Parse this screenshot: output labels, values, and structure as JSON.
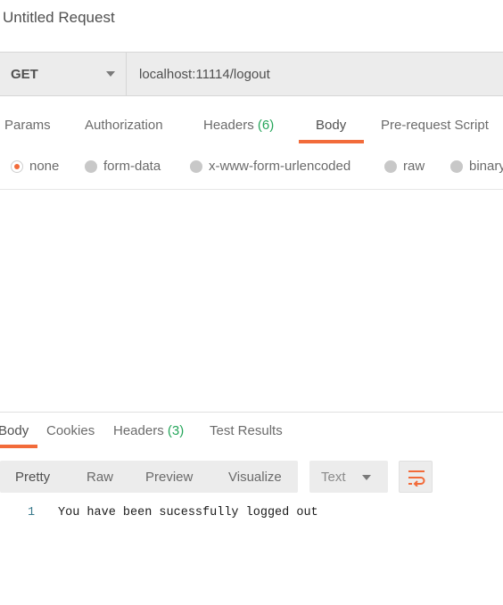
{
  "request": {
    "title": "Untitled Request",
    "method": "GET",
    "url": "localhost:11114/logout"
  },
  "request_tabs": [
    {
      "label": "Params"
    },
    {
      "label": "Authorization"
    },
    {
      "label": "Headers",
      "count": "(6)"
    },
    {
      "label": "Body",
      "active": true
    },
    {
      "label": "Pre-request Script"
    }
  ],
  "body_types": [
    {
      "label": "none",
      "selected": true
    },
    {
      "label": "form-data"
    },
    {
      "label": "x-www-form-urlencoded"
    },
    {
      "label": "raw"
    },
    {
      "label": "binary"
    }
  ],
  "response_tabs": [
    {
      "label": "Body",
      "active": true
    },
    {
      "label": "Cookies"
    },
    {
      "label": "Headers",
      "count": "(3)"
    },
    {
      "label": "Test Results"
    }
  ],
  "view_modes": [
    {
      "label": "Pretty",
      "active": true
    },
    {
      "label": "Raw"
    },
    {
      "label": "Preview"
    },
    {
      "label": "Visualize"
    }
  ],
  "format": {
    "selected": "Text"
  },
  "wrap_icon": "wrap-lines-icon",
  "response_body": [
    {
      "line": "1",
      "text": "You have been sucessfully logged out"
    }
  ],
  "colors": {
    "accent": "#f26b3a",
    "count": "#26a65b",
    "line_number": "#3a7a8c",
    "bar_background": "#ececec"
  }
}
